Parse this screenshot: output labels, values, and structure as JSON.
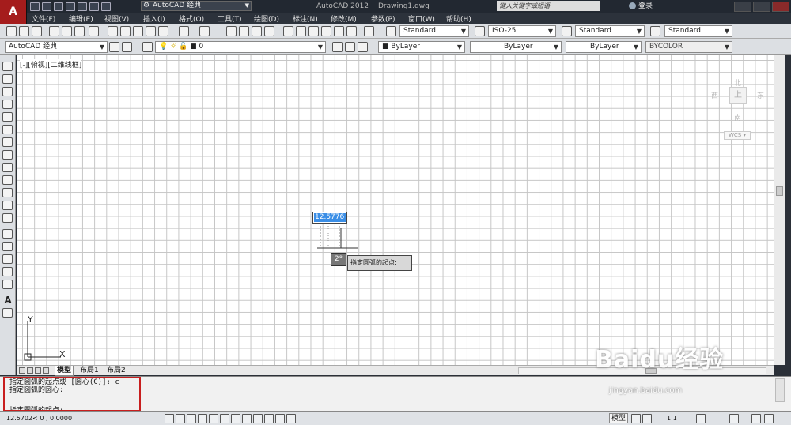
{
  "app": {
    "logo": "A",
    "workspace": "AutoCAD 经典",
    "title": "AutoCAD 2012",
    "file": "Drawing1.dwg",
    "search_placeholder": "键入关键字或短语",
    "login": "登录"
  },
  "menu": [
    "文件(F)",
    "编辑(E)",
    "视图(V)",
    "插入(I)",
    "格式(O)",
    "工具(T)",
    "绘图(D)",
    "标注(N)",
    "修改(M)",
    "参数(P)",
    "窗口(W)",
    "帮助(H)"
  ],
  "toolbar1": {
    "text_style": "Standard",
    "dim_style": "ISO-25",
    "table_style": "Standard",
    "multileader_style": "Standard"
  },
  "toolbar2": {
    "workspace": "AutoCAD 经典",
    "layer": "0",
    "color": "ByLayer",
    "linetype": "ByLayer",
    "lineweight": "ByLayer",
    "plotstyle": "BYCOLOR"
  },
  "viewport": {
    "label": "[-][俯视][二维线框]",
    "viewcube": {
      "north": "北",
      "south": "南",
      "east": "东",
      "west": "西",
      "top": "上",
      "wcs": "WCS"
    },
    "dynamic_value": "12.5776",
    "dynamic_angle": "2°",
    "dynamic_prompt": "指定圆弧的起点:",
    "ucs_x": "X",
    "ucs_y": "Y"
  },
  "tabs": [
    "模型",
    "布局1",
    "布局2"
  ],
  "command": {
    "lines": [
      "指定圆弧的起点或 [圆心(C)]: c",
      "指定圆弧的圆心:"
    ],
    "current": "指定圆弧的起点:"
  },
  "status": {
    "coords": "12.5702<  0        , 0.0000",
    "model": "模型",
    "scale": "1:1"
  },
  "watermark": {
    "brand": "Baidu经验",
    "url": "jingyan.baidu.com"
  }
}
